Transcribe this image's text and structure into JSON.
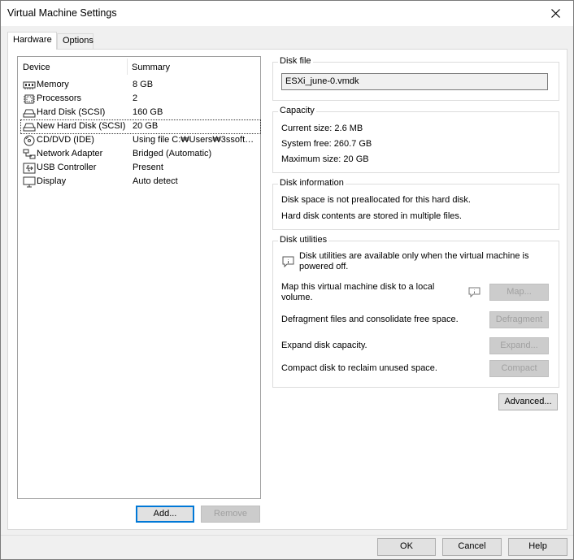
{
  "window": {
    "title": "Virtual Machine Settings",
    "close_icon": "close-icon"
  },
  "tabs": [
    {
      "label": "Hardware",
      "active": true
    },
    {
      "label": "Options",
      "active": false
    }
  ],
  "device_list": {
    "col_device": "Device",
    "col_summary": "Summary",
    "rows": [
      {
        "name": "Memory",
        "summary": "8 GB",
        "icon": "memory-icon"
      },
      {
        "name": "Processors",
        "summary": "2",
        "icon": "processor-icon"
      },
      {
        "name": "Hard Disk (SCSI)",
        "summary": "160 GB",
        "icon": "hard-disk-icon"
      },
      {
        "name": "New Hard Disk (SCSI)",
        "summary": "20 GB",
        "icon": "hard-disk-icon",
        "selected": true
      },
      {
        "name": "CD/DVD (IDE)",
        "summary": "Using file C:₩Users₩3ssoft…",
        "icon": "cd-dvd-icon"
      },
      {
        "name": "Network Adapter",
        "summary": "Bridged (Automatic)",
        "icon": "network-adapter-icon"
      },
      {
        "name": "USB Controller",
        "summary": "Present",
        "icon": "usb-icon"
      },
      {
        "name": "Display",
        "summary": "Auto detect",
        "icon": "display-icon"
      }
    ],
    "add_label": "Add...",
    "remove_label": "Remove"
  },
  "disk_file": {
    "label": "Disk file",
    "value": "ESXi_june-0.vmdk"
  },
  "capacity": {
    "label": "Capacity",
    "current_size": "Current size:  2.6 MB",
    "system_free": "System free:  260.7 GB",
    "maximum_size": "Maximum size:  20 GB"
  },
  "disk_information": {
    "label": "Disk information",
    "line1": "Disk space is not preallocated for this hard disk.",
    "line2": "Hard disk contents are stored in multiple files."
  },
  "disk_utilities": {
    "label": "Disk utilities",
    "notice_line1": "Disk utilities are available only when the virtual machine is",
    "notice_line2": "powered off.",
    "map_desc_line1": "Map this virtual machine disk to a local",
    "map_desc_line2": "volume.",
    "map_label": "Map...",
    "defrag_desc": "Defragment files and consolidate free space.",
    "defrag_label": "Defragment",
    "expand_desc": "Expand disk capacity.",
    "expand_label": "Expand...",
    "compact_desc": "Compact disk to reclaim unused space.",
    "compact_label": "Compact"
  },
  "advanced_label": "Advanced...",
  "footer": {
    "ok_label": "OK",
    "cancel_label": "Cancel",
    "help_label": "Help"
  }
}
